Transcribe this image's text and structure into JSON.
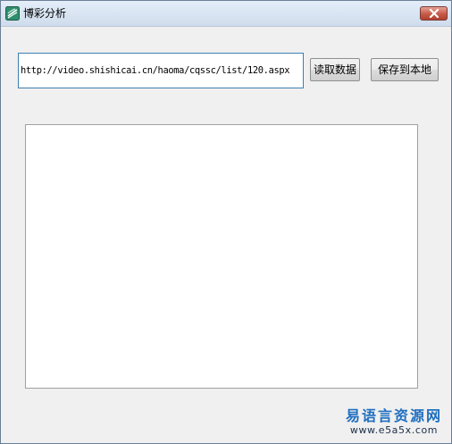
{
  "window": {
    "title": "博彩分析",
    "icon": "app-logo-icon",
    "close_icon": "close-icon"
  },
  "form": {
    "url_value": "http://video.shishicai.cn/haoma/cqssc/list/120.aspx",
    "read_button_label": "读取数据",
    "save_button_label": "保存到本地",
    "output_text": ""
  },
  "watermark": {
    "name": "易语言资源网",
    "site": "www.e5a5x.com"
  },
  "colors": {
    "accent": "#3c7fb1",
    "close": "#c65b48",
    "watermark": "#1f6fbf"
  }
}
